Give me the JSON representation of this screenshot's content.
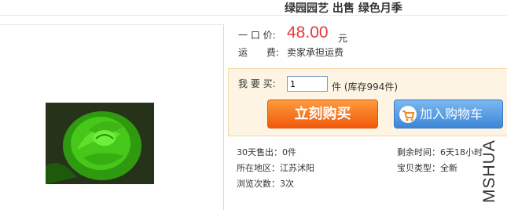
{
  "page": {
    "title": "绿园园艺 出售 绿色月季"
  },
  "price": {
    "label": "一 口 价:",
    "value": "48.00",
    "currency": "元"
  },
  "shipping": {
    "label": "运　　费:",
    "value": "卖家承担运费"
  },
  "buy": {
    "qty_label": "我 要 买:",
    "qty_value": "1",
    "stock_text": "件 (库存994件)"
  },
  "buttons": {
    "buy_now": "立刻购买",
    "add_cart": "加入购物车"
  },
  "info": {
    "sold_30d": "30天售出：0件",
    "remaining": "剩余时间：6天18小时",
    "location": "所在地区：江苏沭阳",
    "item_type": "宝贝类型：全新",
    "views": "浏览次数：3次"
  },
  "watermark": "MSHUA",
  "colors": {
    "price": "#e4393c",
    "buy_button": "#f05a0a",
    "cart_button": "#3d87d8"
  },
  "icons": {
    "cart": "shopping-cart-icon"
  }
}
